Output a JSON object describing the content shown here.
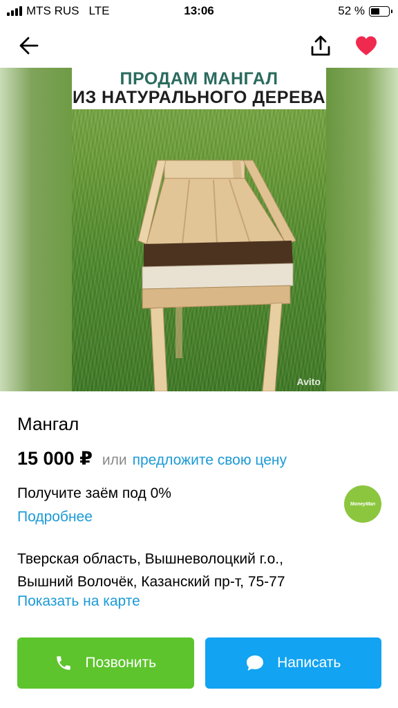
{
  "status_bar": {
    "carrier": "MTS RUS",
    "network": "LTE",
    "time": "13:06",
    "battery": "52 %",
    "battery_level": 0.52
  },
  "nav": {
    "back_icon": "arrow-left-icon",
    "share_icon": "share-icon",
    "favorite_icon": "heart-icon",
    "favorite_color": "#f0294f"
  },
  "gallery": {
    "photo_caption_line1": "ПРОДАМ МАНГАЛ",
    "photo_caption_line2": "ИЗ НАТУРАЛЬНОГО ДЕРЕВА",
    "watermark": "Avito"
  },
  "listing": {
    "title": "Мангал",
    "price": "15 000 ₽",
    "price_or": "или",
    "price_offer_link": "предложите свою цену"
  },
  "loan": {
    "text": "Получите заём под 0%",
    "link": "Подробнее",
    "logo_text": "MoneyMan"
  },
  "location": {
    "address_line1": "Тверская область, Вышневолоцкий г.о.,",
    "address_line2": "Вышний Волочёк, Казанский пр-т, 75-77",
    "map_link": "Показать на карте"
  },
  "actions": {
    "call_label": "Позвонить",
    "call_icon": "phone-icon",
    "write_label": "Написать",
    "write_icon": "chat-bubble-icon",
    "call_color": "#5dc42d",
    "write_color": "#12a3f2"
  },
  "colors": {
    "link": "#1b9ad6"
  }
}
